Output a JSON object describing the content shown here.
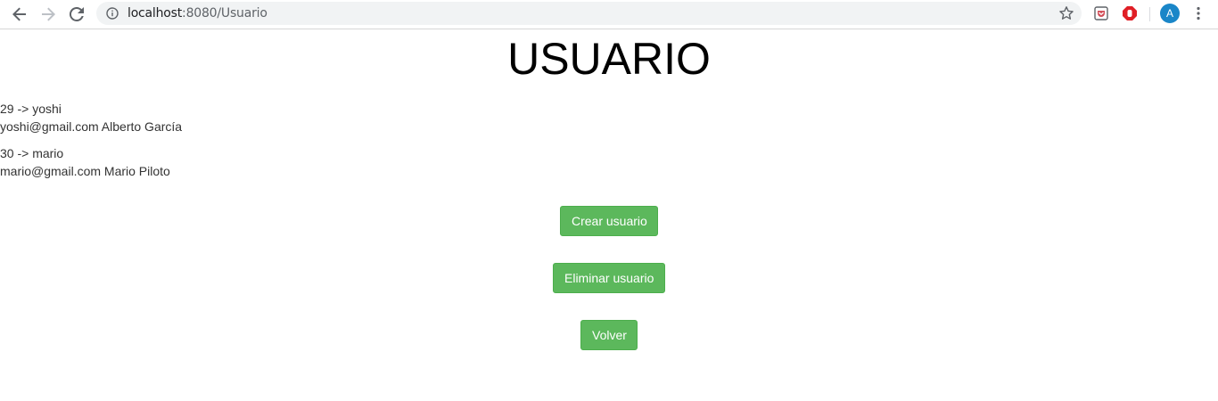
{
  "browser": {
    "url_host": "localhost",
    "url_rest": ":8080/Usuario",
    "avatar_letter": "A",
    "icons": [
      "back-arrow-icon",
      "forward-arrow-icon",
      "reload-icon",
      "info-icon",
      "star-icon",
      "pocket-extension-icon",
      "adblock-extension-icon",
      "chrome-menu-icon"
    ]
  },
  "page": {
    "title": "USUARIO",
    "users": [
      {
        "id_line": "29 -> yoshi",
        "detail_line": "yoshi@gmail.com Alberto García"
      },
      {
        "id_line": "30 -> mario",
        "detail_line": "mario@gmail.com Mario Piloto"
      }
    ],
    "buttons": {
      "crear": "Crear usuario",
      "eliminar": "Eliminar usuario",
      "volver": "Volver"
    }
  },
  "colors": {
    "button_green": "#5cb85c",
    "avatar_blue": "#1a86c8",
    "adblock_red": "#e01f26",
    "pocket_red": "#d3505a"
  }
}
